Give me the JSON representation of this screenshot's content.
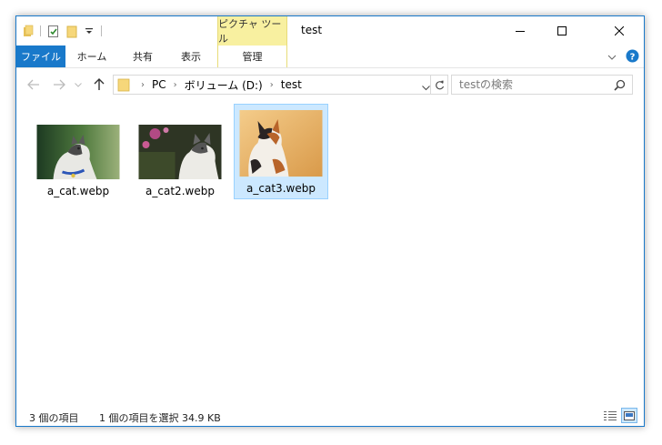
{
  "window": {
    "title": "test"
  },
  "titlebar": {
    "context_tab_header": "ピクチャ ツール"
  },
  "ribbon": {
    "tabs": [
      "ファイル",
      "ホーム",
      "共有",
      "表示",
      "管理"
    ]
  },
  "address": {
    "crumbs": [
      "PC",
      "ボリューム (D:)",
      "test"
    ]
  },
  "search": {
    "placeholder": "testの検索"
  },
  "files": [
    {
      "name": "a_cat.webp",
      "selected": false
    },
    {
      "name": "a_cat2.webp",
      "selected": false
    },
    {
      "name": "a_cat3.webp",
      "selected": true
    }
  ],
  "status": {
    "count": "3 個の項目",
    "selection": "1 個の項目を選択  34.9 KB"
  },
  "colors": {
    "accent": "#1979ca",
    "context_tab": "#f8f0a0",
    "selection": "#cce8ff"
  }
}
